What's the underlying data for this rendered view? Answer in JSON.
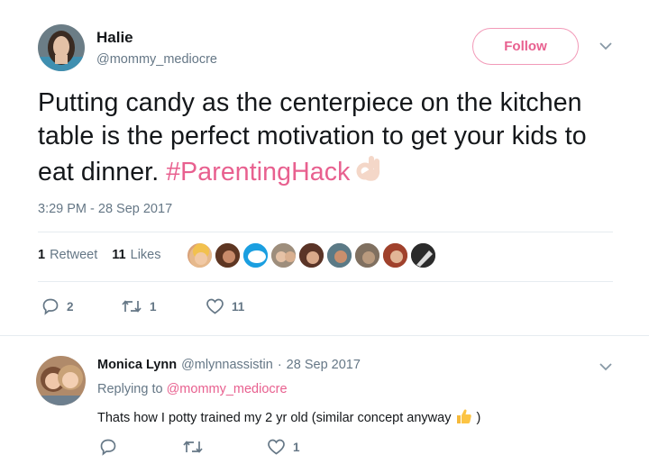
{
  "tweet": {
    "author_name": "Halie",
    "author_handle": "@mommy_mediocre",
    "follow_label": "Follow",
    "text_main": "Putting candy as the centerpiece on the kitchen table is the perfect motivation to get your kids to eat dinner. ",
    "hashtag": "#ParentingHack",
    "emoji_icon": "ok-hand-emoji",
    "timestamp": "3:29 PM - 28 Sep 2017",
    "retweets_count": "1",
    "retweets_label": "Retweet",
    "likes_count": "11",
    "likes_label": "Likes",
    "reply_count": "2",
    "retweet_action_count": "1",
    "like_action_count": "11",
    "accent_color": "#e8608f"
  },
  "reply": {
    "author_name": "Monica Lynn",
    "author_handle": "@mlynnassistin",
    "separator": "·",
    "date": "28 Sep 2017",
    "replying_prefix": "Replying to",
    "replying_to": "@mommy_mediocre",
    "text": "Thats how I potty trained my 2 yr old (similar concept anyway",
    "text_end": ")",
    "emoji_icon": "thumbs-up-emoji",
    "like_count": "1"
  }
}
